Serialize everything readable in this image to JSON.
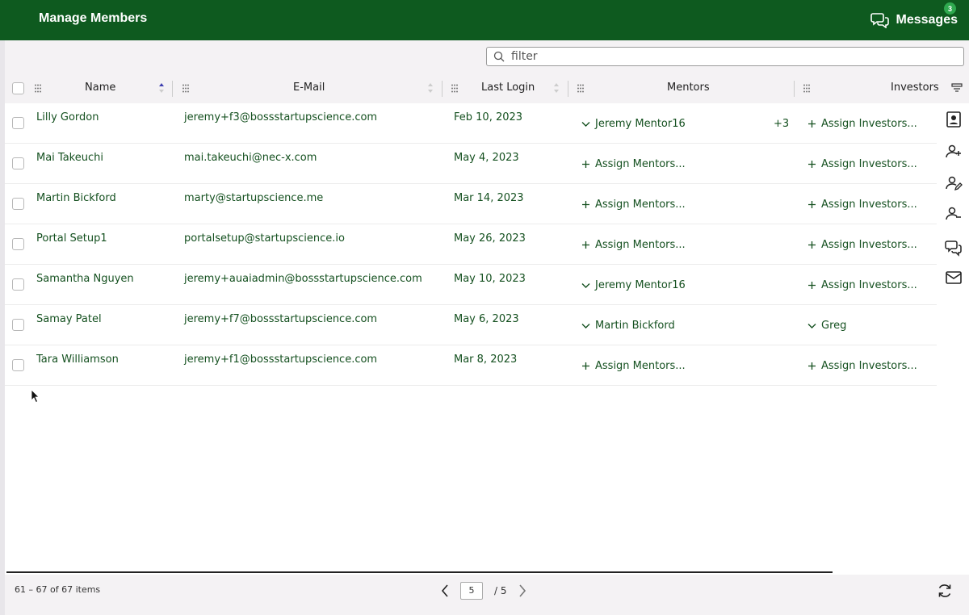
{
  "header": {
    "title": "Manage Members",
    "messages_label": "Messages",
    "messages_count": "3"
  },
  "filter": {
    "placeholder": "filter"
  },
  "columns": {
    "name": "Name",
    "email": "E-Mail",
    "last_login": "Last Login",
    "mentors": "Mentors",
    "investors": "Investors"
  },
  "rows": [
    {
      "name": "Lilly Gordon",
      "email": "jeremy+f3@bossstartupscience.com",
      "last_login": "Feb 10, 2023",
      "mentor": "Jeremy Mentor16",
      "mentor_assigned": true,
      "mentor_more": "+3",
      "investor": "Assign Investors...",
      "investor_assigned": false
    },
    {
      "name": "Mai Takeuchi",
      "email": "mai.takeuchi@nec-x.com",
      "last_login": "May 4, 2023",
      "mentor": "Assign Mentors...",
      "mentor_assigned": false,
      "mentor_more": "",
      "investor": "Assign Investors...",
      "investor_assigned": false
    },
    {
      "name": "Martin Bickford",
      "email": "marty@startupscience.me",
      "last_login": "Mar 14, 2023",
      "mentor": "Assign Mentors...",
      "mentor_assigned": false,
      "mentor_more": "",
      "investor": "Assign Investors...",
      "investor_assigned": false
    },
    {
      "name": "Portal Setup1",
      "email": "portalsetup@startupscience.io",
      "last_login": "May 26, 2023",
      "mentor": "Assign Mentors...",
      "mentor_assigned": false,
      "mentor_more": "",
      "investor": "Assign Investors...",
      "investor_assigned": false
    },
    {
      "name": "Samantha Nguyen",
      "email": "jeremy+auaiadmin@bossstartupscience.com",
      "last_login": "May 10, 2023",
      "mentor": "Jeremy Mentor16",
      "mentor_assigned": true,
      "mentor_more": "",
      "investor": "Assign Investors...",
      "investor_assigned": false
    },
    {
      "name": "Samay Patel",
      "email": "jeremy+f7@bossstartupscience.com",
      "last_login": "May 6, 2023",
      "mentor": "Martin Bickford",
      "mentor_assigned": true,
      "mentor_more": "",
      "investor": "Greg",
      "investor_assigned": true
    },
    {
      "name": "Tara Williamson",
      "email": "jeremy+f1@bossstartupscience.com",
      "last_login": "Mar 8, 2023",
      "mentor": "Assign Mentors...",
      "mentor_assigned": false,
      "mentor_more": "",
      "investor": "Assign Investors...",
      "investor_assigned": false
    }
  ],
  "footer": {
    "items_label": "61 – 67 of 67 items",
    "current_page": "5",
    "total_pages": "/ 5"
  },
  "icons": {
    "side_tools": [
      "contact-card-icon",
      "add-user-icon",
      "edit-user-icon",
      "remove-user-icon",
      "chat-icon",
      "mail-icon"
    ]
  },
  "colors": {
    "header_bg": "#0e5a1f",
    "text_green": "#14501f",
    "badge": "#2fa84f"
  }
}
